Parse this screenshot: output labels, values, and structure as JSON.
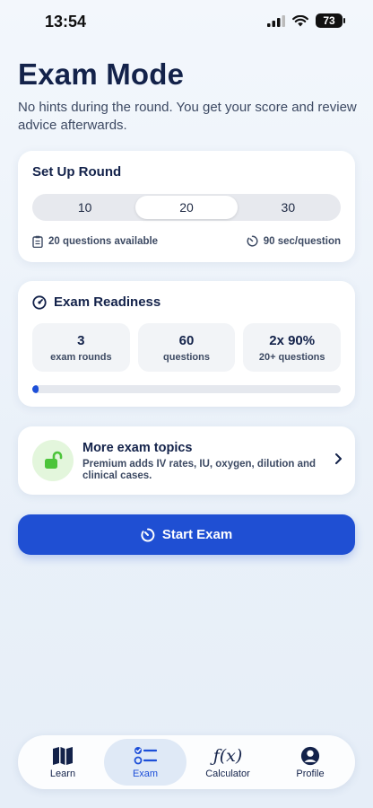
{
  "status_bar": {
    "time": "13:54",
    "battery": "73"
  },
  "header": {
    "title": "Exam Mode",
    "subtitle": "No hints during the round. You get your score and review advice afterwards."
  },
  "setup": {
    "title": "Set Up Round",
    "options": [
      "10",
      "20",
      "30"
    ],
    "selected": "20",
    "available": "20 questions available",
    "time_per_question": "90 sec/question"
  },
  "readiness": {
    "title": "Exam Readiness",
    "stats": [
      {
        "value": "3",
        "label": "exam rounds"
      },
      {
        "value": "60",
        "label": "questions"
      },
      {
        "value": "2x 90%",
        "label": "20+ questions"
      }
    ],
    "progress_fraction": 0.02
  },
  "premium": {
    "title": "More exam topics",
    "description": "Premium adds IV rates, IU, oxygen, dilution and clinical cases."
  },
  "start_button": {
    "label": "Start Exam"
  },
  "tab_bar": {
    "tabs": [
      {
        "label": "Learn",
        "icon": "map-icon"
      },
      {
        "label": "Exam",
        "icon": "checklist-icon"
      },
      {
        "label": "Calculator",
        "icon": "function-icon",
        "glyph": "ƒ(x)"
      },
      {
        "label": "Profile",
        "icon": "person-icon"
      }
    ],
    "active": "Exam"
  },
  "colors": {
    "accent": "#1f4fd3",
    "title": "#13224a",
    "success": "#4cc43a"
  }
}
